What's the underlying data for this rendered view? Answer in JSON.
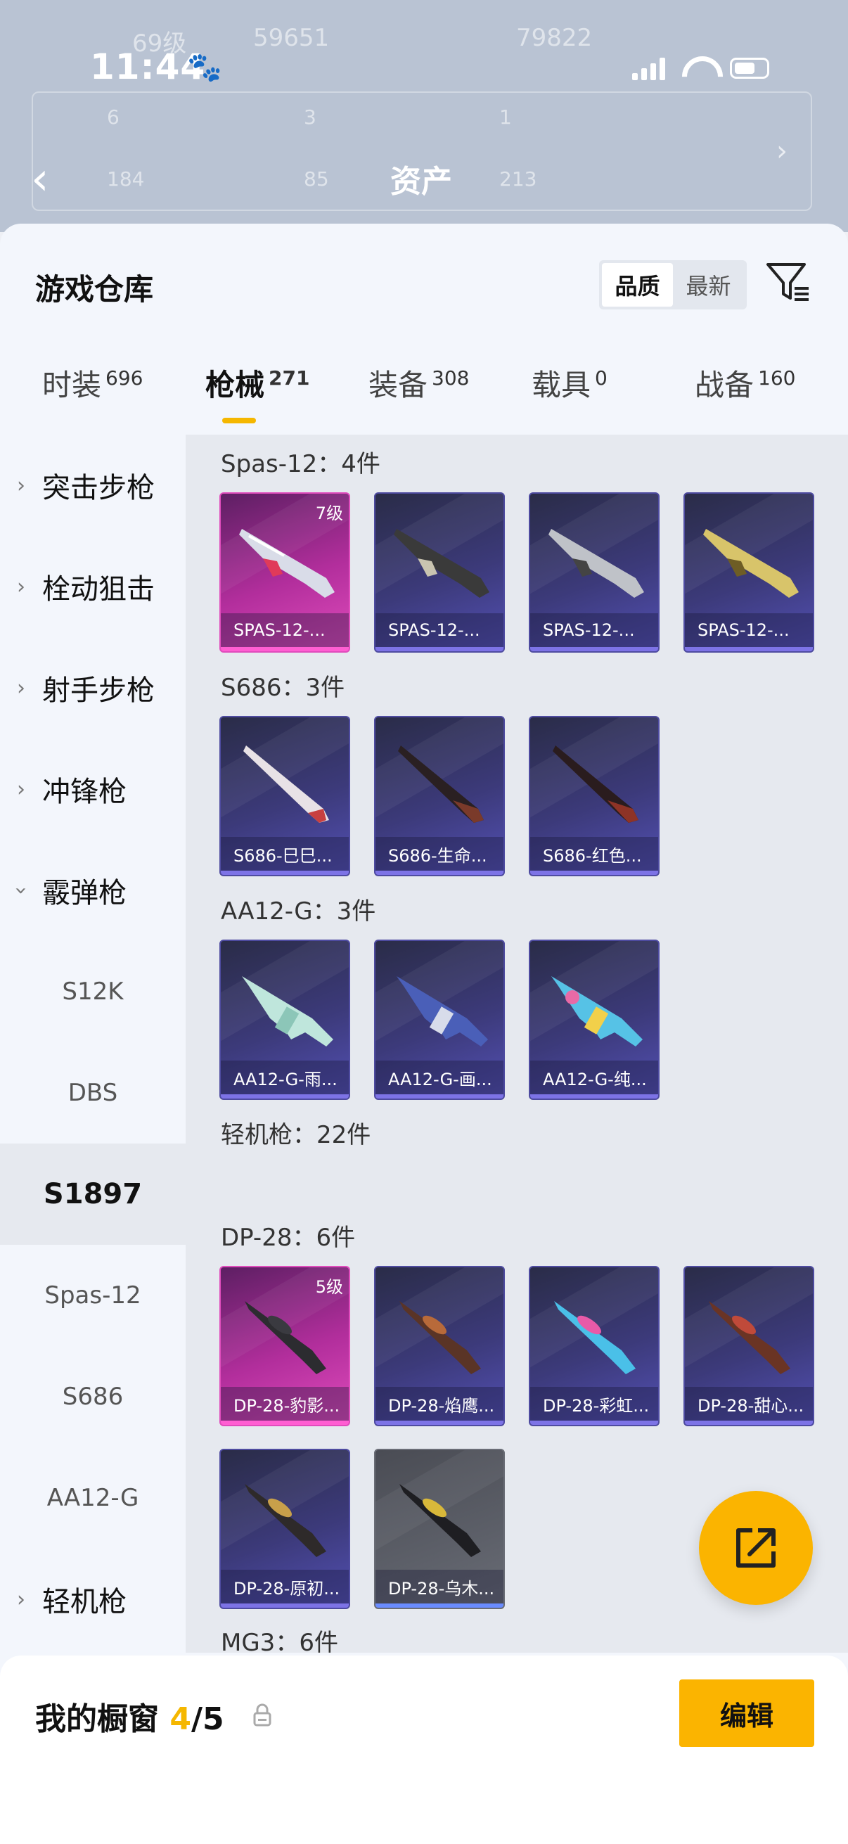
{
  "status_bar": {
    "time": "11:44",
    "paw": "🐾"
  },
  "backdrop": {
    "title": "资产",
    "ghost_texts": [
      "69级",
      "59651",
      "79822",
      "6",
      "3",
      "1",
      "184",
      "85",
      "213"
    ]
  },
  "sheet": {
    "title": "游戏仓库",
    "sort_options": [
      "品质",
      "最新"
    ],
    "active_sort": "品质",
    "tabs": [
      {
        "label": "时装",
        "count": "696"
      },
      {
        "label": "枪械",
        "count": "271"
      },
      {
        "label": "装备",
        "count": "308"
      },
      {
        "label": "载具",
        "count": "0"
      },
      {
        "label": "战备",
        "count": "160"
      }
    ],
    "active_tab": "枪械"
  },
  "sidenav": {
    "items": [
      {
        "label": "突击步枪"
      },
      {
        "label": "栓动狙击"
      },
      {
        "label": "射手步枪"
      },
      {
        "label": "冲锋枪"
      },
      {
        "label": "霰弹枪"
      },
      {
        "label": "S12K"
      },
      {
        "label": "DBS"
      },
      {
        "label": "S1897"
      },
      {
        "label": "Spas-12"
      },
      {
        "label": "S686"
      },
      {
        "label": "AA12-G"
      },
      {
        "label": "轻机枪"
      }
    ],
    "selected": "S1897"
  },
  "content": {
    "sections": [
      {
        "title": "Spas-12：4件"
      },
      {
        "title": "S686：3件"
      },
      {
        "title": "AA12-G：3件"
      },
      {
        "title": "轻机枪：22件"
      },
      {
        "title": "DP-28：6件"
      },
      {
        "title": "MG3：6件"
      }
    ],
    "cards": [
      {
        "label": "SPAS-12-...",
        "level": "7级",
        "rarity": "pink"
      },
      {
        "label": "SPAS-12-...",
        "level": "",
        "rarity": "purple"
      },
      {
        "label": "SPAS-12-...",
        "level": "",
        "rarity": "purple"
      },
      {
        "label": "SPAS-12-...",
        "level": "",
        "rarity": "purple"
      },
      {
        "label": "S686-巳巳...",
        "level": "",
        "rarity": "purple"
      },
      {
        "label": "S686-生命...",
        "level": "",
        "rarity": "purple"
      },
      {
        "label": "S686-红色...",
        "level": "",
        "rarity": "purple"
      },
      {
        "label": "AA12-G-雨...",
        "level": "",
        "rarity": "purple"
      },
      {
        "label": "AA12-G-画...",
        "level": "",
        "rarity": "purple"
      },
      {
        "label": "AA12-G-纯...",
        "level": "",
        "rarity": "purple"
      },
      {
        "label": "DP-28-豹影...",
        "level": "5级",
        "rarity": "pink"
      },
      {
        "label": "DP-28-焰鹰...",
        "level": "",
        "rarity": "purple"
      },
      {
        "label": "DP-28-彩虹...",
        "level": "",
        "rarity": "purple"
      },
      {
        "label": "DP-28-甜心...",
        "level": "",
        "rarity": "purple"
      },
      {
        "label": "DP-28-原初...",
        "level": "",
        "rarity": "purple"
      },
      {
        "label": "DP-28-乌木...",
        "level": "",
        "rarity": "grey"
      }
    ]
  },
  "bottom": {
    "title": "我的橱窗",
    "current": "4",
    "separator": "/",
    "max": "5",
    "edit_label": "编辑"
  },
  "colors": {
    "accent": "#fbb400",
    "rarity_pink": "#e04cbc",
    "rarity_purple": "#5350b4",
    "rarity_grey": "#6a6d76"
  }
}
